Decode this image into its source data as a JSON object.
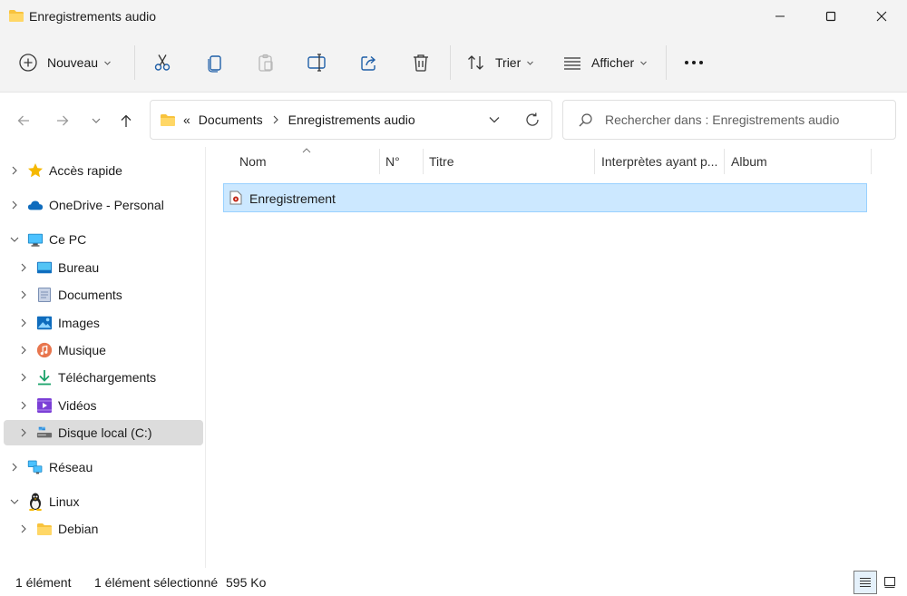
{
  "window": {
    "title": "Enregistrements audio"
  },
  "toolbar": {
    "new_label": "Nouveau",
    "sort_label": "Trier",
    "view_label": "Afficher",
    "more_label": "•••"
  },
  "address": {
    "overflow": "«",
    "crumbs": [
      "Documents",
      "Enregistrements audio"
    ]
  },
  "search": {
    "placeholder": "Rechercher dans : Enregistrements audio"
  },
  "sidebar": {
    "items": [
      {
        "label": "Accès rapide",
        "icon": "star-icon"
      },
      {
        "label": "OneDrive - Personal",
        "icon": "cloud-icon"
      },
      {
        "label": "Ce PC",
        "icon": "monitor-icon"
      },
      {
        "label": "Bureau",
        "icon": "desktop-icon"
      },
      {
        "label": "Documents",
        "icon": "document-icon"
      },
      {
        "label": "Images",
        "icon": "image-icon"
      },
      {
        "label": "Musique",
        "icon": "music-icon"
      },
      {
        "label": "Téléchargements",
        "icon": "download-icon"
      },
      {
        "label": "Vidéos",
        "icon": "video-icon"
      },
      {
        "label": "Disque local (C:)",
        "icon": "drive-icon"
      },
      {
        "label": "Réseau",
        "icon": "network-icon"
      },
      {
        "label": "Linux",
        "icon": "linux-icon"
      },
      {
        "label": "Debian",
        "icon": "folder-icon"
      }
    ]
  },
  "columns": [
    "Nom",
    "N°",
    "Titre",
    "Interprètes ayant p...",
    "Album"
  ],
  "files": [
    {
      "name": "Enregistrement"
    }
  ],
  "status": {
    "count": "1 élément",
    "selected": "1 élément sélectionné",
    "size": "595 Ko"
  },
  "colors": {
    "selection": "#cce8ff",
    "selection_border": "#99d1ff",
    "chrome": "#f3f3f3"
  }
}
